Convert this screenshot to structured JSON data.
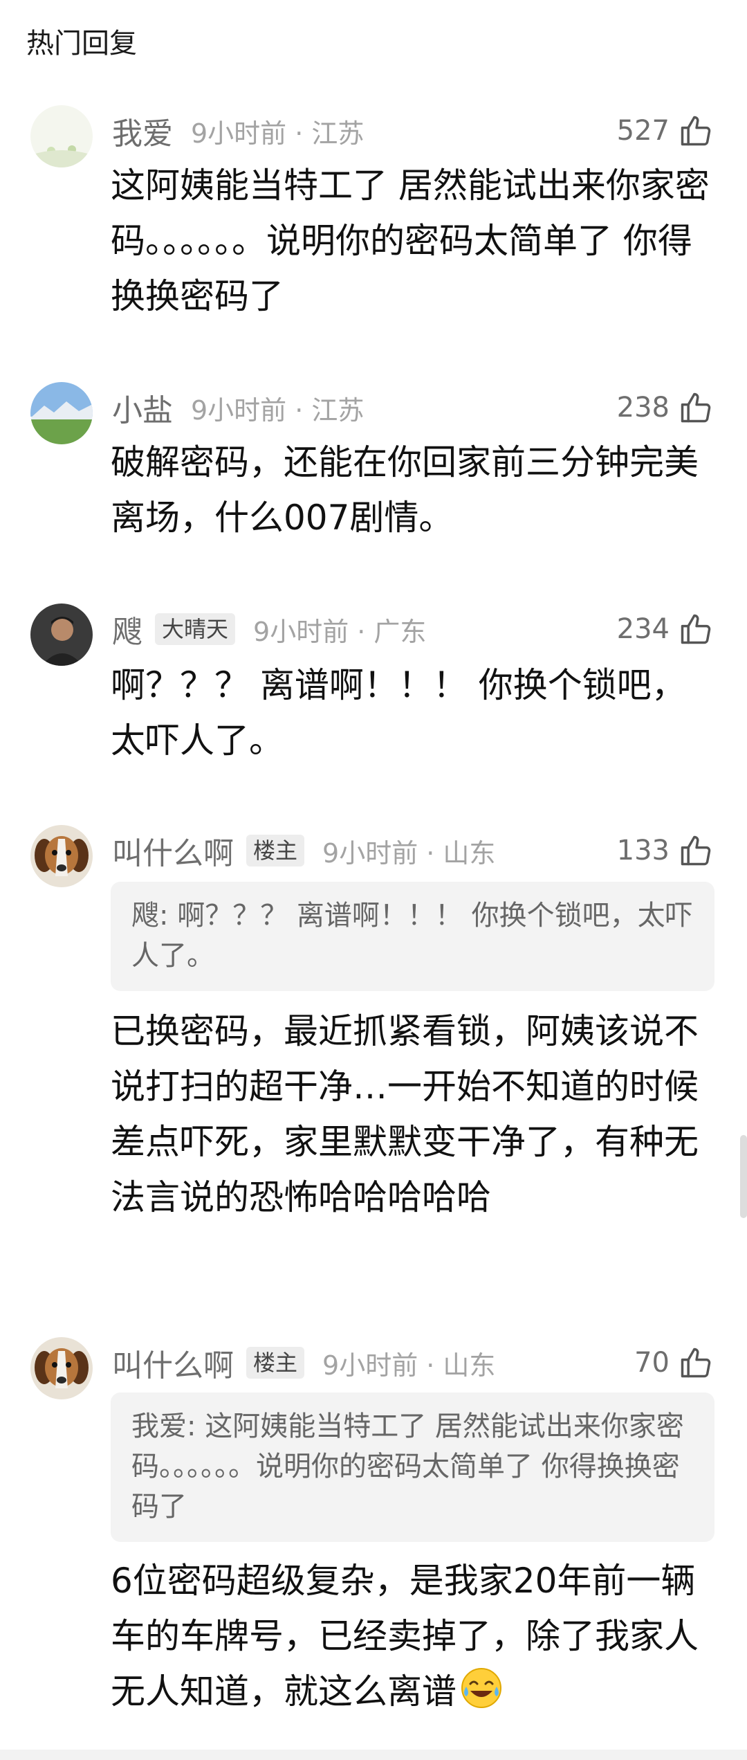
{
  "section_title": "热门回复",
  "comments": [
    {
      "user": "我爱",
      "badge": "",
      "time": "9小时前 · 江苏",
      "likes": "527",
      "quote": "",
      "text": "这阿姨能当特工了   居然能试出来你家密码。。。。。。说明你的密码太简单了  你得换换密码了"
    },
    {
      "user": "小盐",
      "badge": "",
      "time": "9小时前 · 江苏",
      "likes": "238",
      "quote": "",
      "text": "破解密码，还能在你回家前三分钟完美离场，什么007剧情。"
    },
    {
      "user": "飕",
      "badge": "大晴天",
      "time": "9小时前 · 广东",
      "likes": "234",
      "quote": "",
      "text": "啊？？？ 离谱啊！！！ 你换个锁吧，太吓人了。"
    },
    {
      "user": "叫什么啊",
      "badge": "楼主",
      "time": "9小时前 · 山东",
      "likes": "133",
      "quote": "飕: 啊？？？ 离谱啊！！！ 你换个锁吧，太吓人了。",
      "text": "已换密码，最近抓紧看锁，阿姨该说不说打扫的超干净…一开始不知道的时候差点吓死，家里默默变干净了，有种无法言说的恐怖哈哈哈哈哈"
    },
    {
      "user": "叫什么啊",
      "badge": "楼主",
      "time": "9小时前 · 山东",
      "likes": "70",
      "quote": "我爱: 这阿姨能当特工了   居然能试出来你家密码。。。。。。说明你的密码太简单了  你得换换密码了",
      "text": "6位密码超级复杂，是我家20年前一辆车的车牌号，已经卖掉了，除了我家人无人知道，就这么离谱"
    }
  ],
  "colors": {
    "username": "#6e6e6e",
    "time": "#a3a3a3",
    "quote_bg": "#f3f3f3",
    "badge_bg": "#ededed"
  },
  "icons": {
    "like": "thumbs-up-icon",
    "emoji": "laughing-tears-emoji"
  }
}
